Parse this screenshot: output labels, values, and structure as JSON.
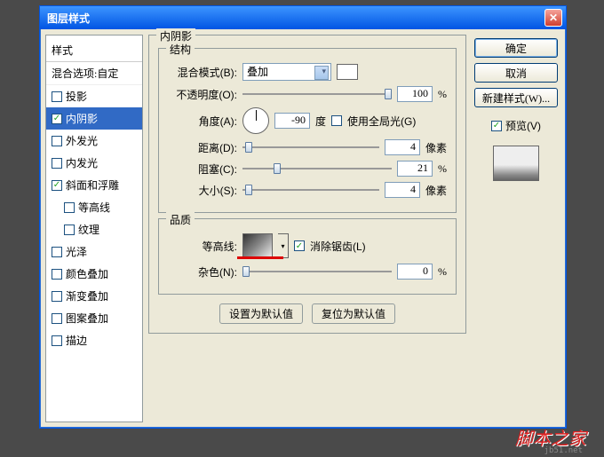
{
  "window": {
    "title": "图层样式"
  },
  "sidebar": {
    "header": "样式",
    "blend_options": "混合选项:自定",
    "items": [
      {
        "label": "投影",
        "checked": false
      },
      {
        "label": "内阴影",
        "checked": true,
        "selected": true
      },
      {
        "label": "外发光",
        "checked": false
      },
      {
        "label": "内发光",
        "checked": false
      },
      {
        "label": "斜面和浮雕",
        "checked": true
      },
      {
        "label": "等高线",
        "checked": false,
        "sub": true
      },
      {
        "label": "纹理",
        "checked": false,
        "sub": true
      },
      {
        "label": "光泽",
        "checked": false
      },
      {
        "label": "颜色叠加",
        "checked": false
      },
      {
        "label": "渐变叠加",
        "checked": false
      },
      {
        "label": "图案叠加",
        "checked": false
      },
      {
        "label": "描边",
        "checked": false
      }
    ]
  },
  "panel": {
    "title": "内阴影",
    "structure": {
      "legend": "结构",
      "blend_mode_label": "混合模式(B):",
      "blend_mode_value": "叠加",
      "opacity_label": "不透明度(O):",
      "opacity_value": "100",
      "opacity_unit": "%",
      "angle_label": "角度(A):",
      "angle_value": "-90",
      "angle_unit": "度",
      "global_light_label": "使用全局光(G)",
      "global_light_checked": false,
      "distance_label": "距离(D):",
      "distance_value": "4",
      "distance_unit": "像素",
      "choke_label": "阻塞(C):",
      "choke_value": "21",
      "choke_unit": "%",
      "size_label": "大小(S):",
      "size_value": "4",
      "size_unit": "像素"
    },
    "quality": {
      "legend": "品质",
      "contour_label": "等高线:",
      "antialias_label": "消除锯齿(L)",
      "antialias_checked": true,
      "noise_label": "杂色(N):",
      "noise_value": "0",
      "noise_unit": "%"
    },
    "buttons": {
      "make_default": "设置为默认值",
      "reset_default": "复位为默认值"
    }
  },
  "right": {
    "ok": "确定",
    "cancel": "取消",
    "new_style": "新建样式(W)...",
    "preview_label": "预览(V)",
    "preview_checked": true
  },
  "watermark": "脚本之家"
}
